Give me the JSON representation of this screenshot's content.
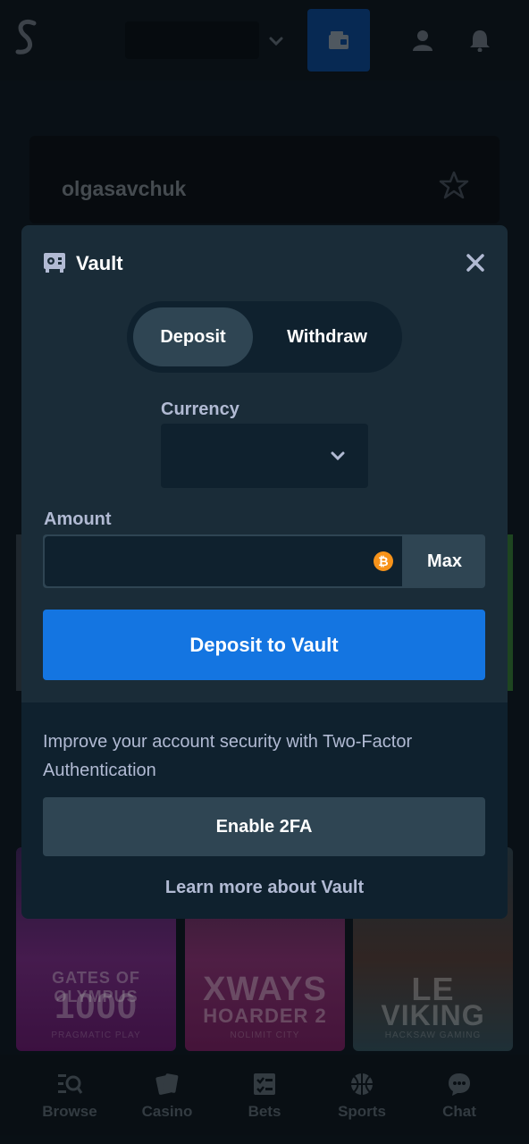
{
  "header": {
    "logo_icon": "stake-s-logo",
    "balance_chevron_icon": "chevron-down-icon",
    "wallet_icon": "wallet-icon",
    "user_icon": "user-icon",
    "bell_icon": "bell-icon"
  },
  "profile": {
    "username": "olgasavchuk",
    "star_icon": "star-icon"
  },
  "games": [
    {
      "title_line1": "GATES OF OLYMPUS",
      "title_line2": "1000",
      "studio": "PRAGMATIC PLAY"
    },
    {
      "title_line1": "XWAYS",
      "title_line2": "HOARDER 2",
      "studio": "NOLIMIT CITY"
    },
    {
      "title_line1": "LE",
      "title_line2": "VIKING",
      "studio": "HACKSAW GAMING"
    }
  ],
  "bottom_nav": {
    "items": [
      {
        "label": "Browse",
        "icon": "browse-search-icon"
      },
      {
        "label": "Casino",
        "icon": "cards-icon"
      },
      {
        "label": "Bets",
        "icon": "bets-list-icon"
      },
      {
        "label": "Sports",
        "icon": "basketball-icon"
      },
      {
        "label": "Chat",
        "icon": "chat-bubble-icon"
      }
    ]
  },
  "vault_modal": {
    "title": "Vault",
    "title_icon": "vault-icon",
    "close_icon": "close-icon",
    "tabs": [
      {
        "label": "Deposit",
        "active": true
      },
      {
        "label": "Withdraw",
        "active": false
      }
    ],
    "currency": {
      "label": "Currency",
      "value": ""
    },
    "amount": {
      "label": "Amount",
      "value": "",
      "currency_icon": "bitcoin-icon",
      "max_label": "Max"
    },
    "deposit_button_label": "Deposit to Vault",
    "security": {
      "message": "Improve your account security with Two-Factor Authentication",
      "enable_2fa_label": "Enable 2FA",
      "learn_more_label": "Learn more about Vault"
    }
  },
  "colors": {
    "modal_bg": "#1a2c38",
    "input_bg": "#0f212e",
    "accent_blue": "#1475e1",
    "secondary_button": "#2f4553",
    "muted_text": "#b1bad3",
    "bitcoin_orange": "#f7931a"
  }
}
